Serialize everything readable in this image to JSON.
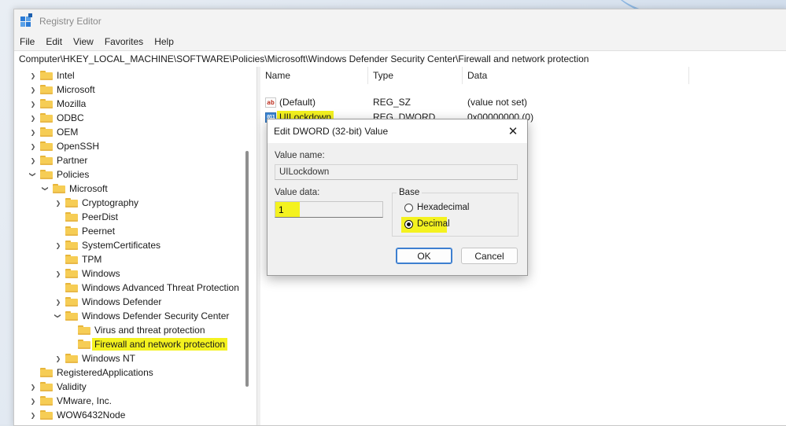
{
  "window": {
    "title": "Registry Editor"
  },
  "menu": [
    "File",
    "Edit",
    "View",
    "Favorites",
    "Help"
  ],
  "address": "Computer\\HKEY_LOCAL_MACHINE\\SOFTWARE\\Policies\\Microsoft\\Windows Defender Security Center\\Firewall and network protection",
  "tree": [
    {
      "label": "Intel",
      "level": 0,
      "chevron": "right"
    },
    {
      "label": "Microsoft",
      "level": 0,
      "chevron": "right"
    },
    {
      "label": "Mozilla",
      "level": 0,
      "chevron": "right"
    },
    {
      "label": "ODBC",
      "level": 0,
      "chevron": "right"
    },
    {
      "label": "OEM",
      "level": 0,
      "chevron": "right"
    },
    {
      "label": "OpenSSH",
      "level": 0,
      "chevron": "right"
    },
    {
      "label": "Partner",
      "level": 0,
      "chevron": "right"
    },
    {
      "label": "Policies",
      "level": 0,
      "chevron": "down"
    },
    {
      "label": "Microsoft",
      "level": 1,
      "chevron": "down"
    },
    {
      "label": "Cryptography",
      "level": 2,
      "chevron": "right"
    },
    {
      "label": "PeerDist",
      "level": 2,
      "chevron": "none"
    },
    {
      "label": "Peernet",
      "level": 2,
      "chevron": "none"
    },
    {
      "label": "SystemCertificates",
      "level": 2,
      "chevron": "right"
    },
    {
      "label": "TPM",
      "level": 2,
      "chevron": "none"
    },
    {
      "label": "Windows",
      "level": 2,
      "chevron": "right"
    },
    {
      "label": "Windows Advanced Threat Protection",
      "level": 2,
      "chevron": "none"
    },
    {
      "label": "Windows Defender",
      "level": 2,
      "chevron": "right"
    },
    {
      "label": "Windows Defender Security Center",
      "level": 2,
      "chevron": "down"
    },
    {
      "label": "Virus and threat protection",
      "level": 3,
      "chevron": "none"
    },
    {
      "label": "Firewall and network protection",
      "level": 3,
      "chevron": "none",
      "highlight": true
    },
    {
      "label": "Windows NT",
      "level": 2,
      "chevron": "right"
    },
    {
      "label": "RegisteredApplications",
      "level": 0,
      "chevron": "none"
    },
    {
      "label": "Validity",
      "level": 0,
      "chevron": "right"
    },
    {
      "label": "VMware, Inc.",
      "level": 0,
      "chevron": "right"
    },
    {
      "label": "WOW6432Node",
      "level": 0,
      "chevron": "right"
    }
  ],
  "list": {
    "headers": {
      "name": "Name",
      "type": "Type",
      "data": "Data"
    },
    "rows": [
      {
        "icon": "string-value-icon",
        "name": "(Default)",
        "type": "REG_SZ",
        "data": "(value not set)"
      },
      {
        "icon": "dword-value-icon",
        "name": "UILockdown",
        "type": "REG_DWORD",
        "data": "0x00000000 (0)",
        "highlight": true
      }
    ]
  },
  "dialog": {
    "title": "Edit DWORD (32-bit) Value",
    "close_glyph": "✕",
    "value_name_label": "Value name:",
    "value_name": "UILockdown",
    "value_data_label": "Value data:",
    "value_data": "1",
    "base_label": "Base",
    "radio_hex": "Hexadecimal",
    "radio_dec": "Decimal",
    "selected_base": "Decimal",
    "ok": "OK",
    "cancel": "Cancel"
  },
  "colors": {
    "highlight": "#f4f21f",
    "accent": "#3d7fd0"
  }
}
